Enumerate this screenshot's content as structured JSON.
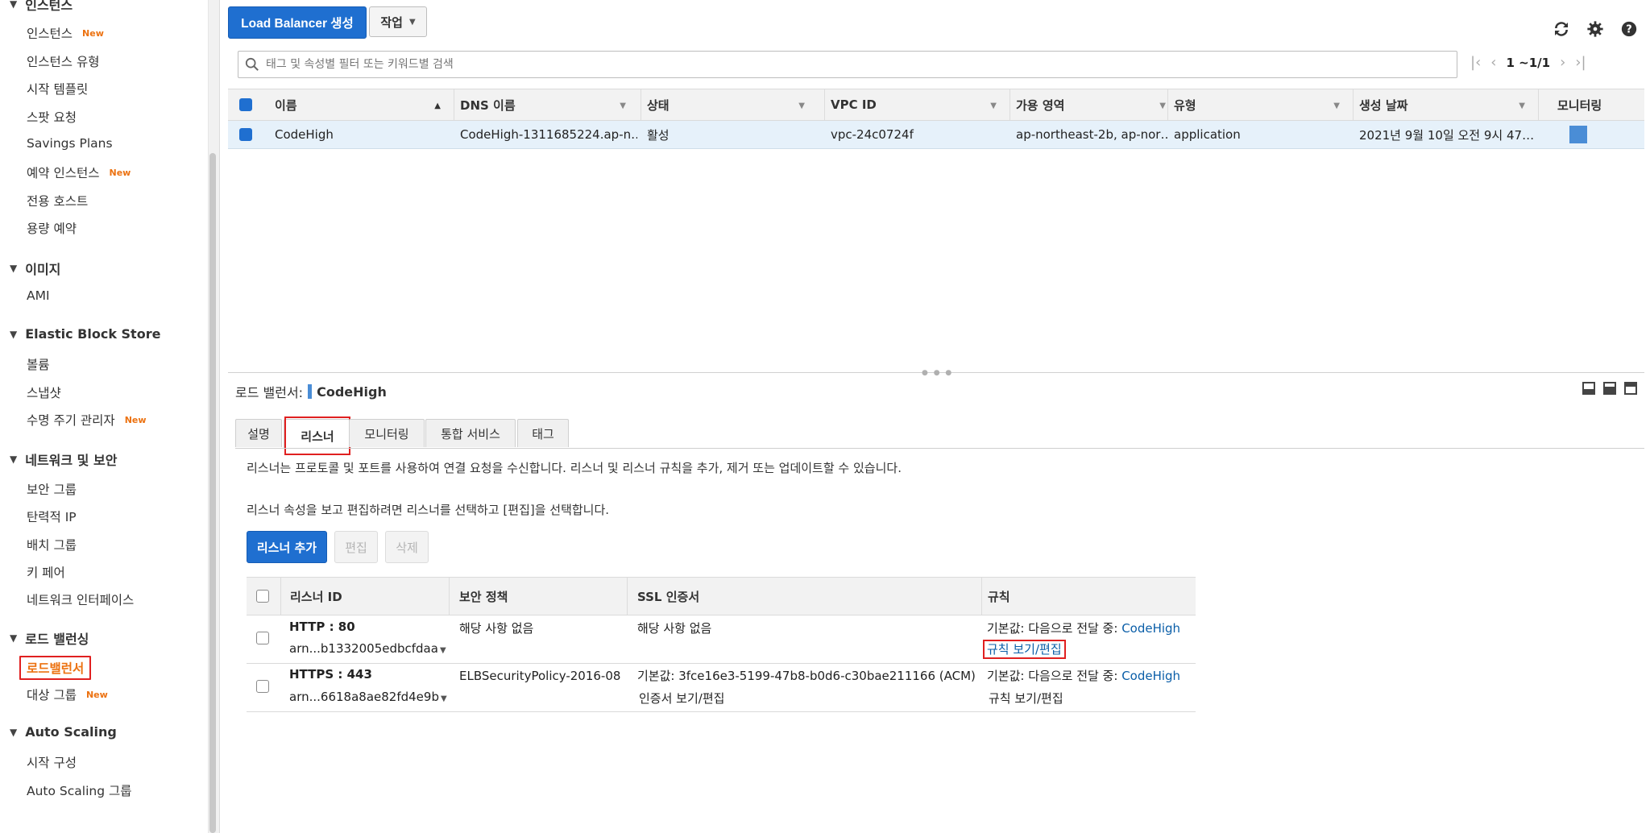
{
  "sidebar": {
    "sections": [
      {
        "label": "인스턴스",
        "items": [
          {
            "label": "인스턴스",
            "badge": "New"
          },
          {
            "label": "인스턴스 유형"
          },
          {
            "label": "시작 템플릿"
          },
          {
            "label": "스팟 요청"
          },
          {
            "label": "Savings Plans"
          },
          {
            "label": "예약 인스턴스",
            "badge": "New"
          },
          {
            "label": "전용 호스트"
          },
          {
            "label": "용량 예약"
          }
        ]
      },
      {
        "label": "이미지",
        "items": [
          {
            "label": "AMI"
          }
        ]
      },
      {
        "label": "Elastic Block Store",
        "items": [
          {
            "label": "볼륨"
          },
          {
            "label": "스냅샷"
          },
          {
            "label": "수명 주기 관리자",
            "badge": "New"
          }
        ]
      },
      {
        "label": "네트워크 및 보안",
        "items": [
          {
            "label": "보안 그룹"
          },
          {
            "label": "탄력적 IP"
          },
          {
            "label": "배치 그룹"
          },
          {
            "label": "키 페어"
          },
          {
            "label": "네트워크 인터페이스"
          }
        ]
      },
      {
        "label": "로드 밸런싱",
        "items": [
          {
            "label": "로드밸런서",
            "active": true
          },
          {
            "label": "대상 그룹",
            "badge": "New"
          }
        ]
      },
      {
        "label": "Auto Scaling",
        "items": [
          {
            "label": "시작 구성"
          },
          {
            "label": "Auto Scaling 그룹"
          }
        ]
      }
    ]
  },
  "toolbar": {
    "create_label": "Load Balancer 생성",
    "actions_label": "작업",
    "icons": [
      "refresh-icon",
      "gear-icon",
      "help-icon"
    ]
  },
  "filter": {
    "placeholder": "태그 및 속성별 필터 또는 키워드별 검색",
    "pager_text": "1 ~1/1"
  },
  "lb_table": {
    "columns": [
      "이름",
      "DNS 이름",
      "상태",
      "VPC ID",
      "가용 영역",
      "유형",
      "생성 날짜",
      "모니터링"
    ],
    "rows": [
      {
        "name": "CodeHigh",
        "dns": "CodeHigh-1311685224.ap-n…",
        "state": "활성",
        "vpc": "vpc-24c0724f",
        "az": "ap-northeast-2b, ap-nor…",
        "type": "application",
        "created": "2021년 9월 10일 오전 9시 47…",
        "selected": true
      }
    ]
  },
  "detail": {
    "title_label": "로드 밸런서:",
    "title_name": "CodeHigh",
    "tabs": [
      "설명",
      "리스너",
      "모니터링",
      "통합 서비스",
      "태그"
    ],
    "active_tab": "리스너",
    "desc1": "리스너는 프로토콜 및 포트를 사용하여 연결 요청을 수신합니다. 리스너 및 리스너 규칙을 추가, 제거 또는 업데이트할 수 있습니다.",
    "desc2": "리스너 속성을 보고 편집하려면 리스너를 선택하고 [편집]을 선택합니다.",
    "buttons": {
      "add": "리스너 추가",
      "edit": "편집",
      "delete": "삭제"
    }
  },
  "listeners": {
    "columns": [
      "리스너 ID",
      "보안 정책",
      "SSL 인증서",
      "규칙"
    ],
    "rows": [
      {
        "protocol": "HTTP : 80",
        "arn": "arn...b1332005edbcfdaa",
        "policy": "해당 사항 없음",
        "ssl": "해당 사항 없음",
        "ssl_link": "",
        "rule_prefix": "기본값:  다음으로 전달 중: ",
        "rule_target": "CodeHigh",
        "rule_link": "규칙 보기/편집"
      },
      {
        "protocol": "HTTPS : 443",
        "arn": "arn...6618a8ae82fd4e9b",
        "policy": "ELBSecurityPolicy-2016-08",
        "ssl": "기본값:  3fce16e3-5199-47b8-b0d6-c30bae211166 (ACM)",
        "ssl_link": "인증서 보기/편집",
        "rule_prefix": "기본값:  다음으로 전달 중: ",
        "rule_target": "CodeHigh",
        "rule_link": "규칙 보기/편집"
      }
    ]
  },
  "colors": {
    "primary": "#1f6fd0",
    "selected_row": "#e6f1fa",
    "highlight_red": "#e02020",
    "new_badge": "#ec7211",
    "link": "#0a5ea8"
  }
}
